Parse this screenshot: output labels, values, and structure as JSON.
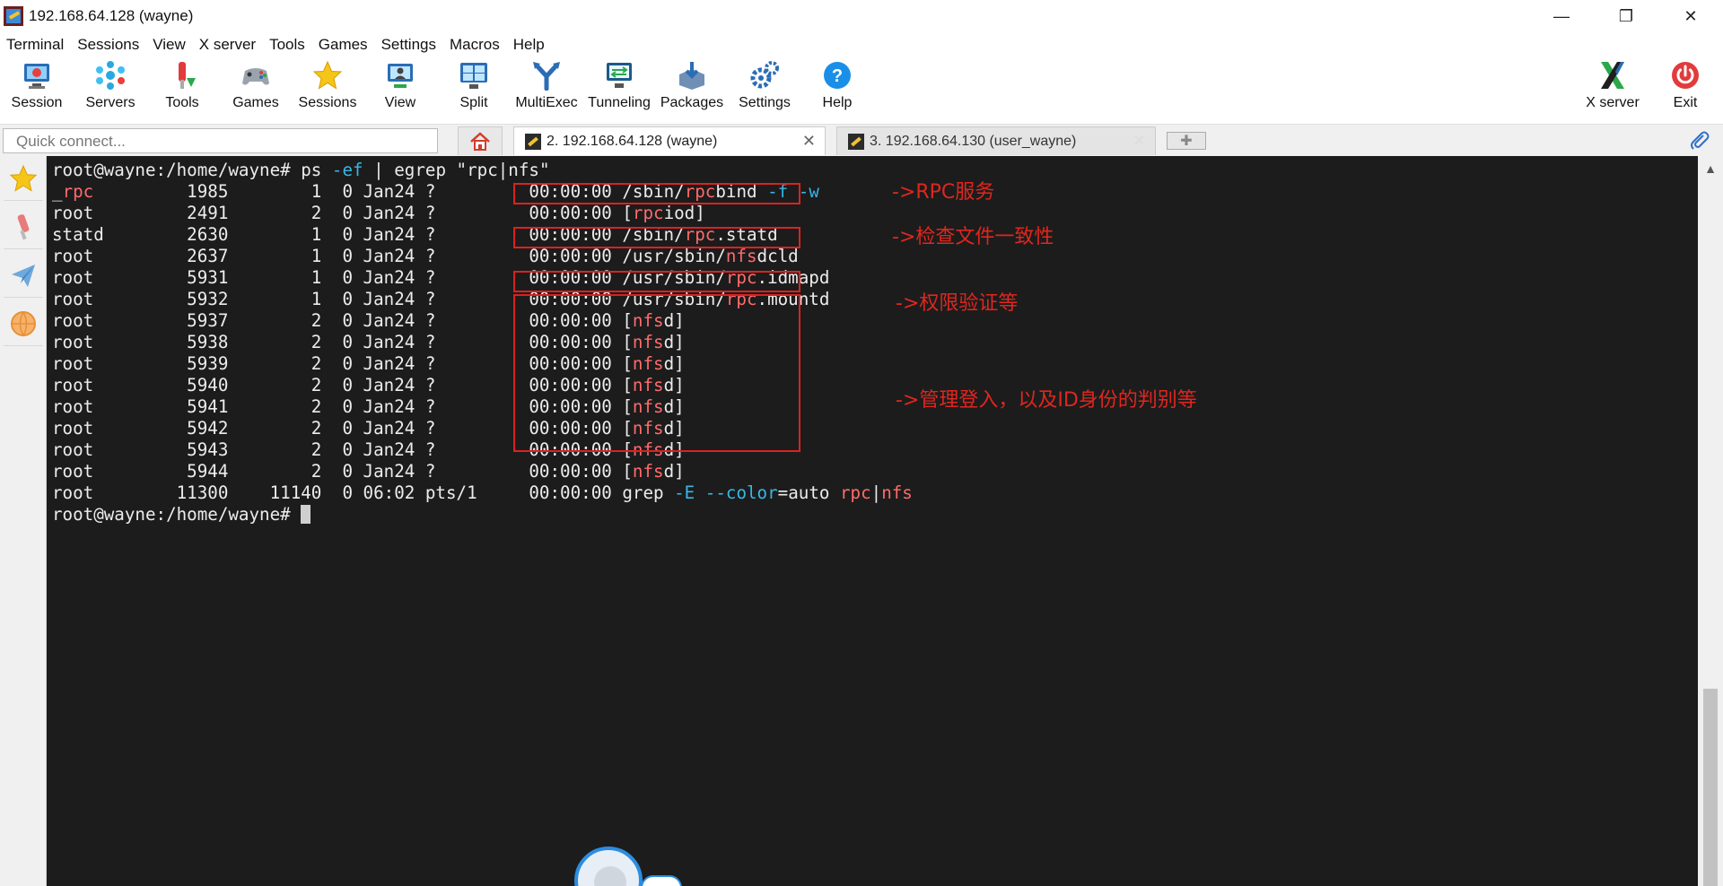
{
  "window": {
    "title": "192.168.64.128 (wayne)",
    "controls": {
      "minimize": "—",
      "maximize": "❐",
      "close": "✕"
    }
  },
  "menu": [
    "Terminal",
    "Sessions",
    "View",
    "X server",
    "Tools",
    "Games",
    "Settings",
    "Macros",
    "Help"
  ],
  "toolbar": {
    "session": "Session",
    "servers": "Servers",
    "tools": "Tools",
    "games": "Games",
    "sessions": "Sessions",
    "view": "View",
    "split": "Split",
    "multiexec": "MultiExec",
    "tunneling": "Tunneling",
    "packages": "Packages",
    "settings": "Settings",
    "help": "Help",
    "xserver": "X server",
    "exit": "Exit"
  },
  "quick_connect": {
    "placeholder": "Quick connect..."
  },
  "tabs": [
    {
      "label": "2. 192.168.64.128 (wayne)",
      "active": true
    },
    {
      "label": "3. 192.168.64.130 (user_wayne)",
      "active": false
    }
  ],
  "terminal": {
    "prompt": "root@wayne:/home/wayne#",
    "command": "ps -ef | egrep \"rpc|nfs\"",
    "lines": [
      {
        "user": "_rpc",
        "pid": "1985",
        "ppid": "1",
        "c": "0",
        "stime": "Jan24",
        "tty": "?",
        "time": "00:00:00",
        "cmd": "/sbin/rpcbind -f -w"
      },
      {
        "user": "root",
        "pid": "2491",
        "ppid": "2",
        "c": "0",
        "stime": "Jan24",
        "tty": "?",
        "time": "00:00:00",
        "cmd": "[rpciod]"
      },
      {
        "user": "statd",
        "pid": "2630",
        "ppid": "1",
        "c": "0",
        "stime": "Jan24",
        "tty": "?",
        "time": "00:00:00",
        "cmd": "/sbin/rpc.statd"
      },
      {
        "user": "root",
        "pid": "2637",
        "ppid": "1",
        "c": "0",
        "stime": "Jan24",
        "tty": "?",
        "time": "00:00:00",
        "cmd": "/usr/sbin/nfsdcld"
      },
      {
        "user": "root",
        "pid": "5931",
        "ppid": "1",
        "c": "0",
        "stime": "Jan24",
        "tty": "?",
        "time": "00:00:00",
        "cmd": "/usr/sbin/rpc.idmapd"
      },
      {
        "user": "root",
        "pid": "5932",
        "ppid": "1",
        "c": "0",
        "stime": "Jan24",
        "tty": "?",
        "time": "00:00:00",
        "cmd": "/usr/sbin/rpc.mountd"
      },
      {
        "user": "root",
        "pid": "5937",
        "ppid": "2",
        "c": "0",
        "stime": "Jan24",
        "tty": "?",
        "time": "00:00:00",
        "cmd": "[nfsd]"
      },
      {
        "user": "root",
        "pid": "5938",
        "ppid": "2",
        "c": "0",
        "stime": "Jan24",
        "tty": "?",
        "time": "00:00:00",
        "cmd": "[nfsd]"
      },
      {
        "user": "root",
        "pid": "5939",
        "ppid": "2",
        "c": "0",
        "stime": "Jan24",
        "tty": "?",
        "time": "00:00:00",
        "cmd": "[nfsd]"
      },
      {
        "user": "root",
        "pid": "5940",
        "ppid": "2",
        "c": "0",
        "stime": "Jan24",
        "tty": "?",
        "time": "00:00:00",
        "cmd": "[nfsd]"
      },
      {
        "user": "root",
        "pid": "5941",
        "ppid": "2",
        "c": "0",
        "stime": "Jan24",
        "tty": "?",
        "time": "00:00:00",
        "cmd": "[nfsd]"
      },
      {
        "user": "root",
        "pid": "5942",
        "ppid": "2",
        "c": "0",
        "stime": "Jan24",
        "tty": "?",
        "time": "00:00:00",
        "cmd": "[nfsd]"
      },
      {
        "user": "root",
        "pid": "5943",
        "ppid": "2",
        "c": "0",
        "stime": "Jan24",
        "tty": "?",
        "time": "00:00:00",
        "cmd": "[nfsd]"
      },
      {
        "user": "root",
        "pid": "5944",
        "ppid": "2",
        "c": "0",
        "stime": "Jan24",
        "tty": "?",
        "time": "00:00:00",
        "cmd": "[nfsd]"
      },
      {
        "user": "root",
        "pid": "11300",
        "ppid": "11140",
        "c": "0",
        "stime": "06:02",
        "tty": "pts/1",
        "time": "00:00:00",
        "cmd": "grep -E --color=auto rpc|nfs"
      }
    ],
    "highlight_word": "rpc|nfs",
    "colors": {
      "match": "#ff6b6b",
      "option": "#38b6e8",
      "text": "#ececec",
      "background": "#1c1c1c"
    }
  },
  "annotations": {
    "rpc_service": "->RPC服务",
    "statd": "->检查文件一致性",
    "mountd": "->权限验证等",
    "nfsd": "->管理登入，以及ID身份的判别等",
    "color": "#e0261e"
  }
}
